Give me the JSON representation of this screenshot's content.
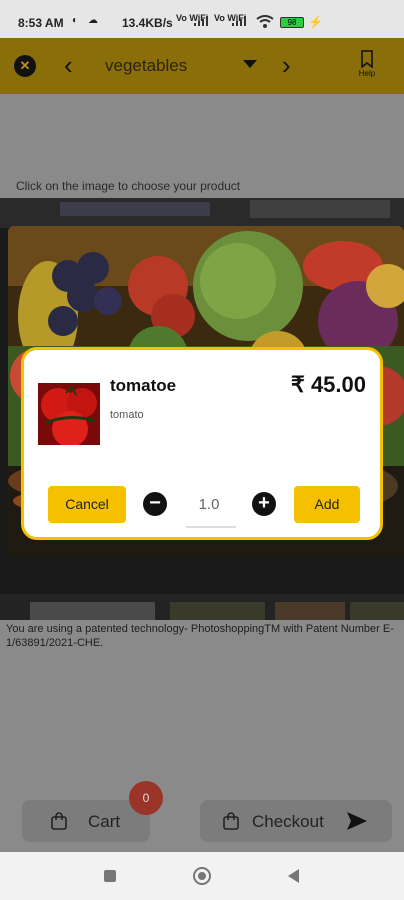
{
  "status_bar": {
    "time": "8:53 AM",
    "speed": "13.4KB/s",
    "net_1": "Vo WiFi",
    "net_2": "Vo WiFi",
    "battery": "98"
  },
  "toolbar": {
    "category": "vegetables",
    "help_label": "Help",
    "close_icon": "close-circle-icon",
    "prev_icon": "chevron-left-icon",
    "next_icon": "chevron-right-icon",
    "dropdown_icon": "caret-down-icon",
    "help_icon": "bookmark-icon"
  },
  "main": {
    "hint": "Click on the image to choose your product",
    "notice": "You are using a patented technology- PhotoshoppingTM with Patent Number E-1/63891/2021-CHE."
  },
  "dialog": {
    "product_name": "tomatoe",
    "product_desc": "tomato",
    "price": "₹ 45.00",
    "quantity": "1.0",
    "cancel_label": "Cancel",
    "add_label": "Add"
  },
  "bottom": {
    "cart_label": "Cart",
    "cart_count": "0",
    "checkout_label": "Checkout"
  },
  "colors": {
    "accent": "#f5c000",
    "toolbar_dimmed": "#8a6e0a",
    "badge": "#9a3428"
  }
}
